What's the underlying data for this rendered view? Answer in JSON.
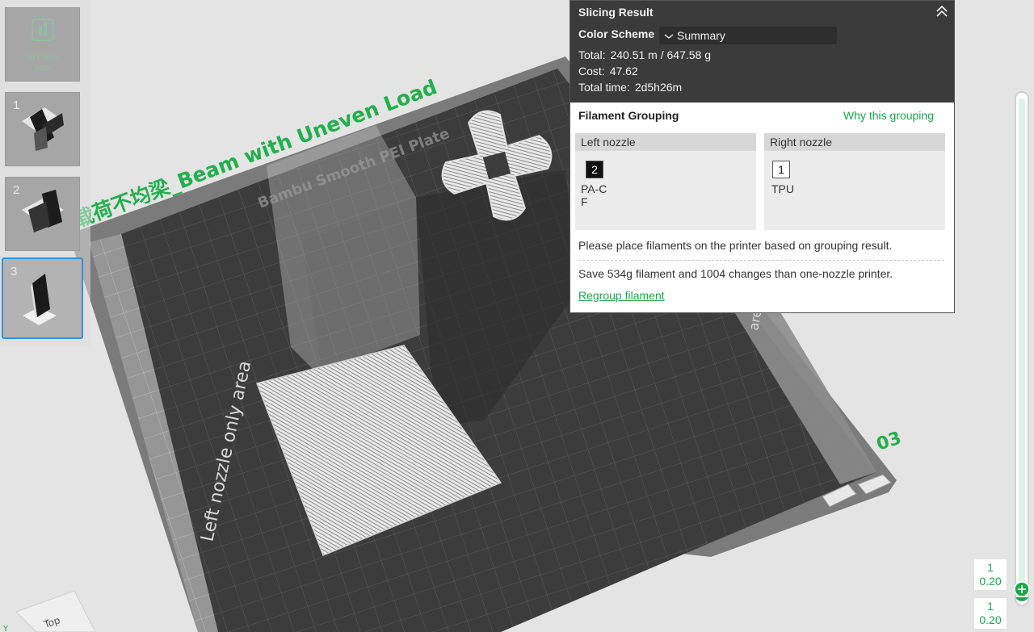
{
  "scene": {
    "plate_title": "载荷不均梁_Beam with Uneven Load",
    "plate_surface": "Bambu Smooth PEI Plate",
    "left_zone_label": "Left nozzle only area",
    "right_zone_label": "area",
    "plate_number": "03"
  },
  "thumbnails": {
    "all_plates_label": "All Plates",
    "all_plates_sub": "Stats",
    "items": [
      {
        "number": "1"
      },
      {
        "number": "2"
      },
      {
        "number": "3"
      }
    ]
  },
  "slicing_result": {
    "title": "Slicing Result",
    "color_scheme_label": "Color Scheme",
    "color_scheme_value": "Summary",
    "total_label": "Total:",
    "total_value": "240.51 m / 647.58 g",
    "cost_label": "Cost:",
    "cost_value": "47.62",
    "time_label": "Total time:",
    "time_value": "2d5h26m"
  },
  "filament_grouping": {
    "title": "Filament Grouping",
    "why_link": "Why this grouping",
    "left_nozzle": {
      "header": "Left nozzle",
      "chip": "2",
      "name_line1": "PA-C",
      "name_line2": "F"
    },
    "right_nozzle": {
      "header": "Right nozzle",
      "chip": "1",
      "name_line1": "TPU"
    },
    "place_text": "Please place filaments on the printer based on grouping result.",
    "save_text": "Save 534g filament and 1004 changes than one-nozzle printer.",
    "regroup_link": "Regroup filament"
  },
  "layer_slider": {
    "top_layer": "1",
    "top_height": "0.20",
    "bottom_layer": "1",
    "bottom_height": "0.20"
  },
  "nav_cube": {
    "face_label": "Top"
  },
  "colors": {
    "accent_green": "#1aa84a",
    "panel_dark": "#3b3b3b",
    "selection_blue": "#3a8fd8"
  }
}
